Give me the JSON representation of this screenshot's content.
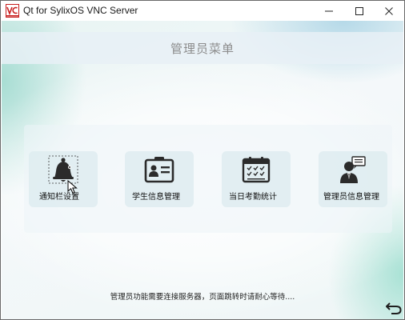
{
  "window": {
    "title": "Qt for SylixOS VNC Server",
    "app_icon": "qt-vnc-app-icon"
  },
  "controls": {
    "minimize": "minimize-icon",
    "maximize": "maximize-icon",
    "close": "close-icon"
  },
  "header": {
    "title": "管理员菜单"
  },
  "menu": {
    "items": [
      {
        "label": "通知栏设置",
        "icon": "bell-icon",
        "selected": true
      },
      {
        "label": "学生信息管理",
        "icon": "id-card-icon",
        "selected": false
      },
      {
        "label": "当日考勤统计",
        "icon": "calendar-icon",
        "selected": false
      },
      {
        "label": "管理员信息管理",
        "icon": "admin-user-icon",
        "selected": false
      }
    ]
  },
  "notice": {
    "text": "管理员功能需要连接服务器，页面跳转时请耐心等待...."
  },
  "back": {
    "icon": "back-arrow-icon"
  },
  "colors": {
    "icon_dark": "#2b2b2b",
    "header_text": "#8c8c8c",
    "qt_red": "#c81e1e"
  }
}
